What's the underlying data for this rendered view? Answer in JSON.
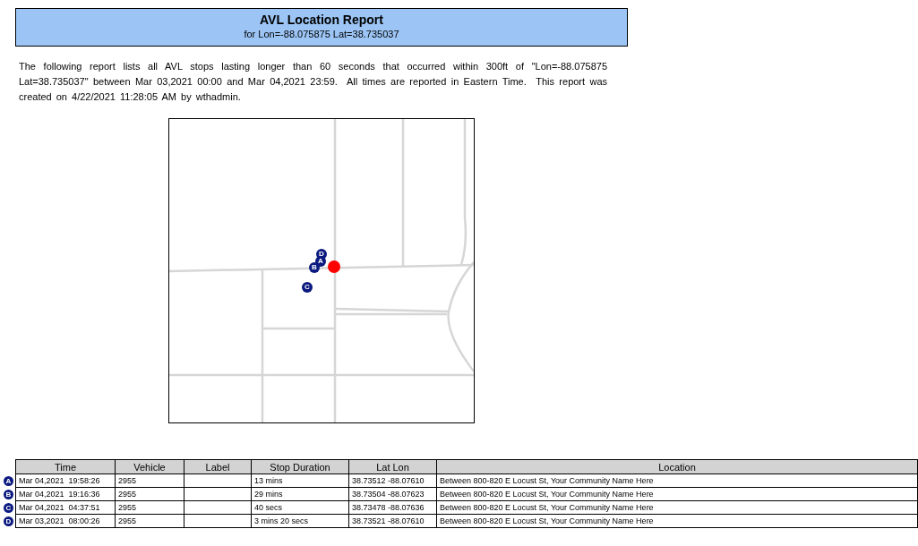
{
  "header": {
    "title": "AVL Location Report",
    "subtitle": "for Lon=-88.075875 Lat=38.735037"
  },
  "description": "The following report lists all AVL stops lasting longer than 60 seconds that occurred within 300ft of \"Lon=-88.075875 Lat=38.735037\" between Mar 03,2021 00:00 and Mar 04,2021 23:59.  All times are reported in Eastern Time.  This report was created on 4/22/2021 11:28:05 AM by wthadmin.",
  "map": {
    "markers": [
      {
        "label": "D"
      },
      {
        "label": "A"
      },
      {
        "label": "B"
      },
      {
        "label": "C"
      }
    ]
  },
  "table": {
    "columns": [
      "Time",
      "Vehicle",
      "Label",
      "Stop Duration",
      "Lat Lon",
      "Location"
    ],
    "rows": [
      {
        "marker": "A",
        "cells": [
          "Mar 04,2021  19:58:26",
          "2955",
          "",
          "13 mins",
          "38.73512 -88.07610",
          "Between 800-820 E Locust St, Your Community Name Here"
        ]
      },
      {
        "marker": "B",
        "cells": [
          "Mar 04,2021  19:16:36",
          "2955",
          "",
          "29 mins",
          "38.73504 -88.07623",
          "Between 800-820 E Locust St, Your Community Name Here"
        ]
      },
      {
        "marker": "C",
        "cells": [
          "Mar 04,2021  04:37:51",
          "2955",
          "",
          "40 secs",
          "38.73478 -88.07636",
          "Between 800-820 E Locust St, Your Community Name Here"
        ]
      },
      {
        "marker": "D",
        "cells": [
          "Mar 03,2021  08:00:26",
          "2955",
          "",
          "3 mins 20 secs",
          "38.73521 -88.07610",
          "Between 800-820 E Locust St, Your Community Name Here"
        ]
      }
    ]
  }
}
